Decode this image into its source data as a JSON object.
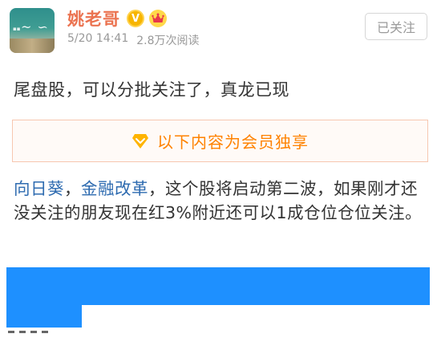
{
  "post": {
    "author": {
      "name": "姚老哥",
      "verified_badge": "V"
    },
    "meta": {
      "timestamp": "5/20 14:41",
      "read_count": "2.8万次阅读"
    },
    "follow_button_label": "已关注",
    "title": "尾盘股，可以分批关注了，真龙已现",
    "member_notice": "以下内容为会员独享",
    "body": {
      "topic_1": "向日葵",
      "separator": "，",
      "topic_2": "金融改革",
      "text": "，这个股将启动第二波，如果刚才还没关注的朋友现在红3%附近还可以1成仓位仓位关注。"
    }
  },
  "icons": {
    "verified": "verified-v-icon",
    "vip": "crown-icon",
    "member": "diamond-icon"
  },
  "colors": {
    "author_name": "#eb7350",
    "topic_link": "#2e6bb0",
    "member_accent": "#ff8200",
    "redaction": "#1e90ff",
    "meta_text": "#999999"
  }
}
